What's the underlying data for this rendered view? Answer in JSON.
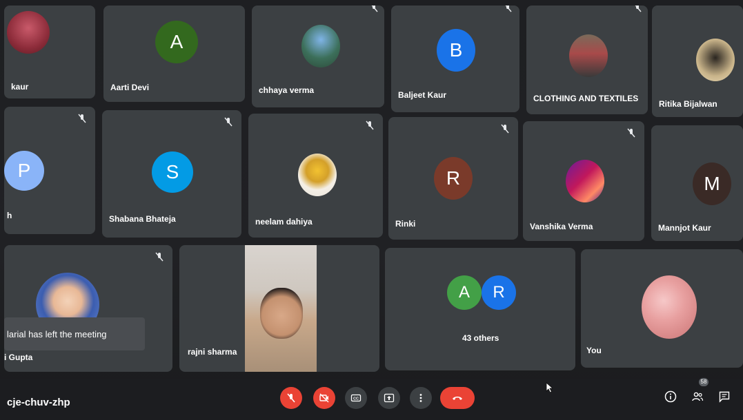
{
  "meeting": {
    "code": "cje-chuv-zhp"
  },
  "row1": [
    {
      "name": "kaur"
    },
    {
      "name": "Aarti Devi",
      "initial": "A",
      "color": "#33691e"
    },
    {
      "name": "chhaya verma"
    },
    {
      "name": "Baljeet Kaur",
      "initial": "B",
      "color": "#1a73e8"
    },
    {
      "name": "CLOTHING AND TEXTILES"
    },
    {
      "name": "Ritika Bijalwan"
    }
  ],
  "row2": [
    {
      "name": "h",
      "initial": "P",
      "color": "#8ab4f8"
    },
    {
      "name": "Shabana Bhateja",
      "initial": "S",
      "color": "#039be5"
    },
    {
      "name": "neelam dahiya"
    },
    {
      "name": "Rinki",
      "initial": "R",
      "color": "#7a3a2a"
    },
    {
      "name": "Vanshika Verma"
    },
    {
      "name": "Mannjot Kaur",
      "initial": "M",
      "color": "#3a2a26"
    }
  ],
  "row3": [
    {
      "name": "i Gupta"
    },
    {
      "name": "rajni sharma"
    },
    {
      "name": "43 others",
      "initials": [
        "A",
        "R"
      ],
      "colors": [
        "#43a047",
        "#1a73e8"
      ]
    },
    {
      "name": "You"
    }
  ],
  "toast": {
    "text": "larial has left the meeting"
  },
  "participants_badge": "58",
  "icons": [
    "mic-off-icon",
    "camera-off-icon",
    "captions-icon",
    "present-icon",
    "more-icon",
    "end-call-icon",
    "info-icon",
    "people-icon",
    "chat-icon"
  ]
}
